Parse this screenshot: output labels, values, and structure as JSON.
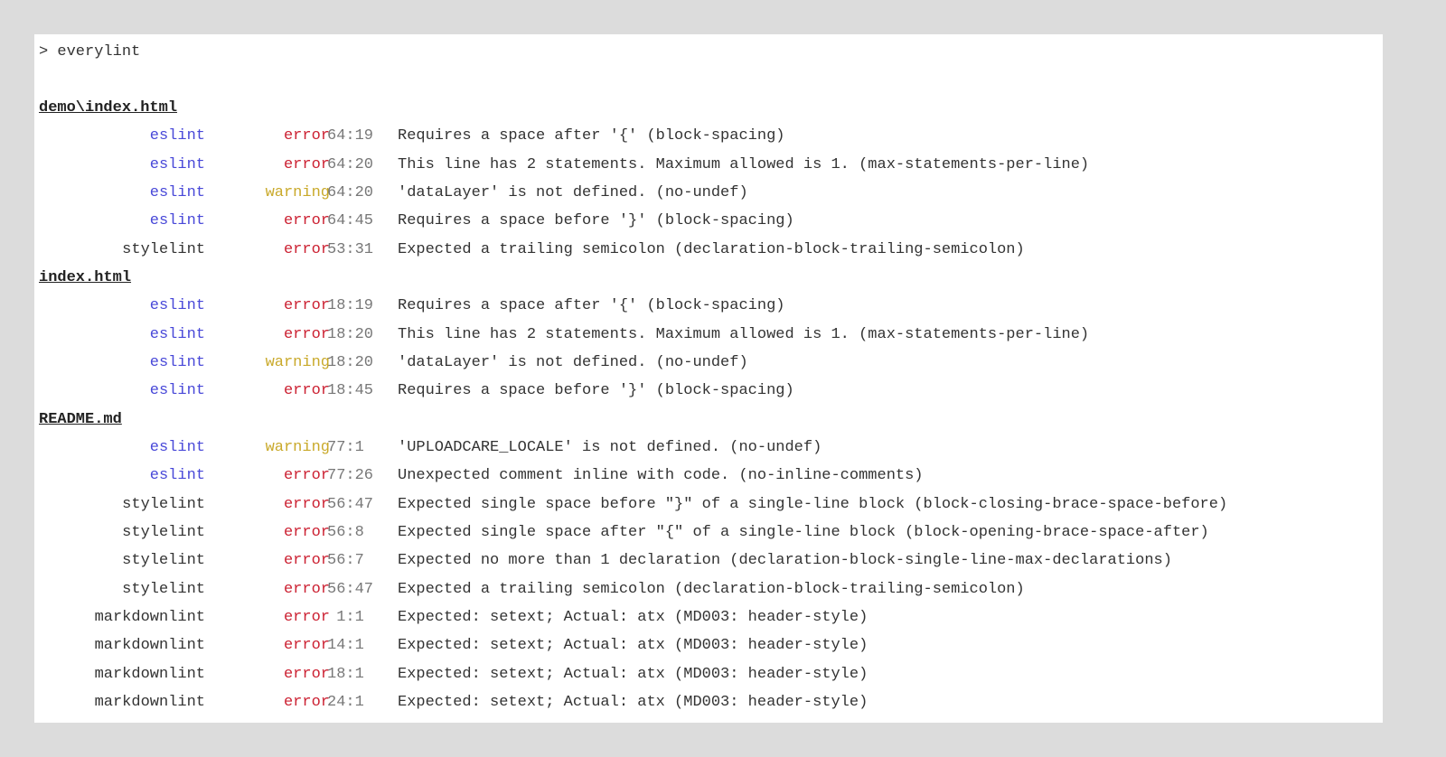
{
  "terminal": {
    "command": "> everylint",
    "colors": {
      "eslint": "#4848d8",
      "error": "#cc2233",
      "warning": "#c9a92a",
      "position": "#777777",
      "text": "#333333",
      "background": "#ffffff",
      "page_background": "#dcdcdc"
    },
    "files": [
      {
        "name": "demo\\index.html",
        "results": [
          {
            "linter": "eslint",
            "severity": "error",
            "position": "64:19",
            "message": "Requires a space after '{' (block-spacing)"
          },
          {
            "linter": "eslint",
            "severity": "error",
            "position": "64:20",
            "message": "This line has 2 statements. Maximum allowed is 1. (max-statements-per-line)"
          },
          {
            "linter": "eslint",
            "severity": "warning",
            "position": "64:20",
            "message": "'dataLayer' is not defined. (no-undef)"
          },
          {
            "linter": "eslint",
            "severity": "error",
            "position": "64:45",
            "message": "Requires a space before '}' (block-spacing)"
          },
          {
            "linter": "stylelint",
            "severity": "error",
            "position": "53:31",
            "message": "Expected a trailing semicolon (declaration-block-trailing-semicolon)"
          }
        ]
      },
      {
        "name": "index.html",
        "results": [
          {
            "linter": "eslint",
            "severity": "error",
            "position": "18:19",
            "message": "Requires a space after '{' (block-spacing)"
          },
          {
            "linter": "eslint",
            "severity": "error",
            "position": "18:20",
            "message": "This line has 2 statements. Maximum allowed is 1. (max-statements-per-line)"
          },
          {
            "linter": "eslint",
            "severity": "warning",
            "position": "18:20",
            "message": "'dataLayer' is not defined. (no-undef)"
          },
          {
            "linter": "eslint",
            "severity": "error",
            "position": "18:45",
            "message": "Requires a space before '}' (block-spacing)"
          }
        ]
      },
      {
        "name": "README.md",
        "results": [
          {
            "linter": "eslint",
            "severity": "warning",
            "position": "77:1",
            "message": "'UPLOADCARE_LOCALE' is not defined. (no-undef)"
          },
          {
            "linter": "eslint",
            "severity": "error",
            "position": "77:26",
            "message": "Unexpected comment inline with code. (no-inline-comments)"
          },
          {
            "linter": "stylelint",
            "severity": "error",
            "position": "56:47",
            "message": "Expected single space before \"}\" of a single-line block (block-closing-brace-space-before)"
          },
          {
            "linter": "stylelint",
            "severity": "error",
            "position": "56:8",
            "message": "Expected single space after \"{\" of a single-line block (block-opening-brace-space-after)"
          },
          {
            "linter": "stylelint",
            "severity": "error",
            "position": "56:7",
            "message": "Expected no more than 1 declaration (declaration-block-single-line-max-declarations)"
          },
          {
            "linter": "stylelint",
            "severity": "error",
            "position": "56:47",
            "message": "Expected a trailing semicolon (declaration-block-trailing-semicolon)"
          },
          {
            "linter": "markdownlint",
            "severity": "error",
            "position": "1:1",
            "message": "Expected: setext; Actual: atx (MD003: header-style)"
          },
          {
            "linter": "markdownlint",
            "severity": "error",
            "position": "14:1",
            "message": "Expected: setext; Actual: atx (MD003: header-style)"
          },
          {
            "linter": "markdownlint",
            "severity": "error",
            "position": "18:1",
            "message": "Expected: setext; Actual: atx (MD003: header-style)"
          },
          {
            "linter": "markdownlint",
            "severity": "error",
            "position": "24:1",
            "message": "Expected: setext; Actual: atx (MD003: header-style)"
          }
        ]
      }
    ]
  }
}
